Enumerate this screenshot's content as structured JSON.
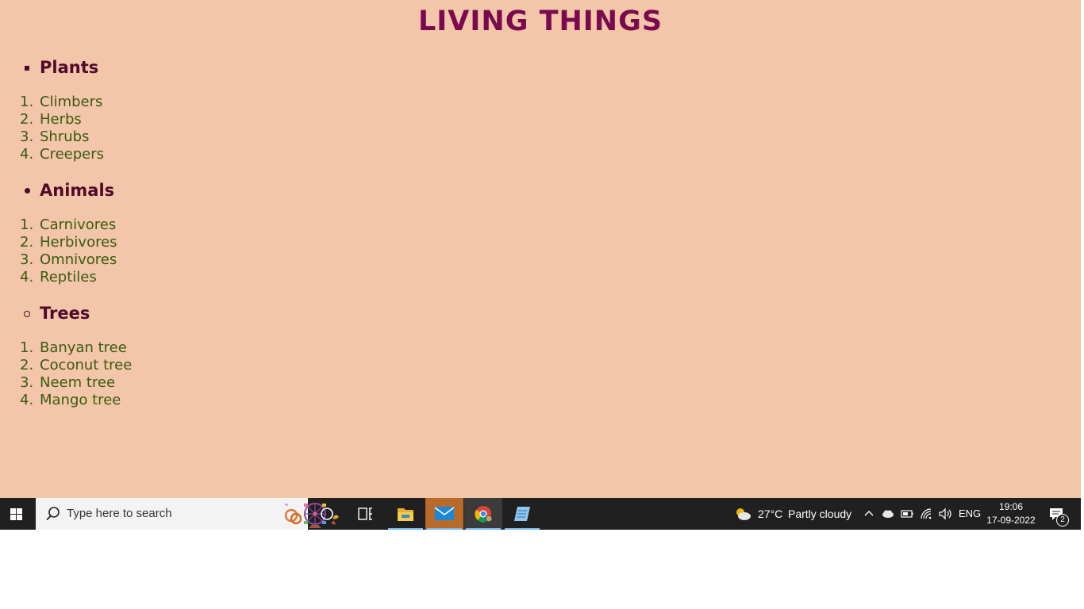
{
  "page": {
    "title": "LIVING THINGS",
    "categories": [
      {
        "heading": "Plants",
        "bullet": "square",
        "items": [
          "Climbers",
          "Herbs",
          "Shrubs",
          "Creepers"
        ]
      },
      {
        "heading": "Animals",
        "bullet": "disc",
        "items": [
          "Carnivores",
          "Herbivores",
          "Omnivores",
          "Reptiles"
        ]
      },
      {
        "heading": "Trees",
        "bullet": "circle",
        "items": [
          "Banyan tree",
          "Coconut tree",
          "Neem tree",
          "Mango tree"
        ]
      }
    ],
    "colors": {
      "background": "#f3c6a9",
      "title": "#7a0a4e",
      "heading": "#4f0a2a",
      "item": "#3a5a10"
    }
  },
  "taskbar": {
    "search_placeholder": "Type here to search",
    "pinned": [
      {
        "icon": "cortana-circle-icon"
      },
      {
        "icon": "task-view-icon"
      },
      {
        "icon": "file-explorer-icon"
      },
      {
        "icon": "mail-icon"
      },
      {
        "icon": "chrome-icon"
      },
      {
        "icon": "notepad-icon"
      }
    ],
    "weather": {
      "temp": "27°C",
      "condition": "Partly cloudy"
    },
    "language": "ENG",
    "time": "19:06",
    "date": "17-09-2022",
    "notification_count": "2"
  }
}
